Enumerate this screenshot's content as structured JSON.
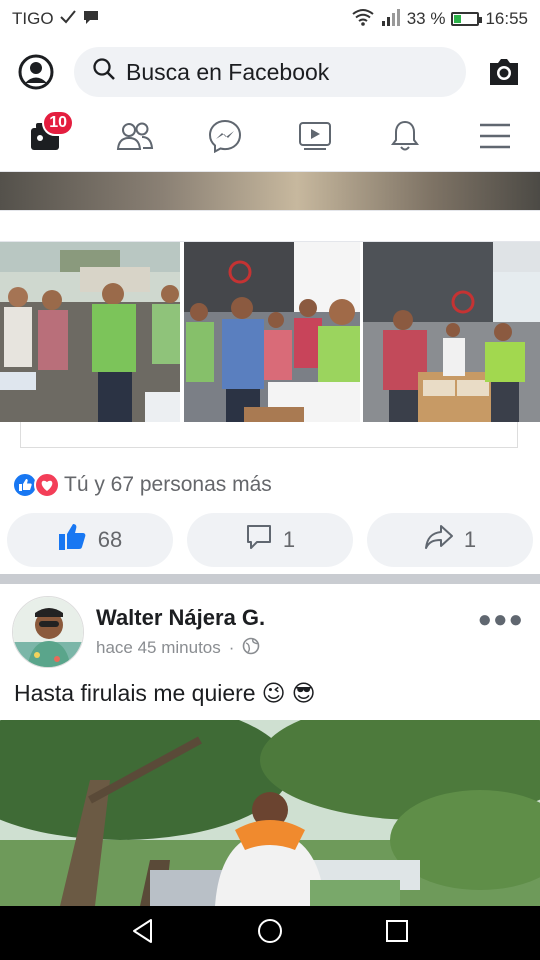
{
  "status": {
    "carrier": "TIGO",
    "battery": "33 %",
    "battery_level": 0.33,
    "time": "16:55"
  },
  "topbar": {
    "search_placeholder": "Busca en Facebook"
  },
  "nav": {
    "badge_count": "10"
  },
  "post1": {
    "reactions_text": "Tú y 67 personas más",
    "like_count": "68",
    "comment_count": "1",
    "share_count": "1"
  },
  "post2": {
    "author": "Walter Nájera G.",
    "time": "hace 45 minutos",
    "separator": "·",
    "text": "Hasta firulais me quiere",
    "emojis": [
      "😉",
      "😎"
    ]
  },
  "colors": {
    "brand": "#1877f2",
    "badge": "#e41e3f",
    "love": "#f33e58",
    "muted": "#65676b"
  },
  "icons": [
    "profile-icon",
    "search-icon",
    "camera-icon",
    "home-icon",
    "friends-icon",
    "messenger-icon",
    "watch-icon",
    "notifications-icon",
    "menu-icon",
    "like-icon",
    "love-icon",
    "comment-icon",
    "share-icon",
    "globe-icon",
    "more-icon",
    "back-icon",
    "home-nav-icon",
    "recents-icon"
  ]
}
